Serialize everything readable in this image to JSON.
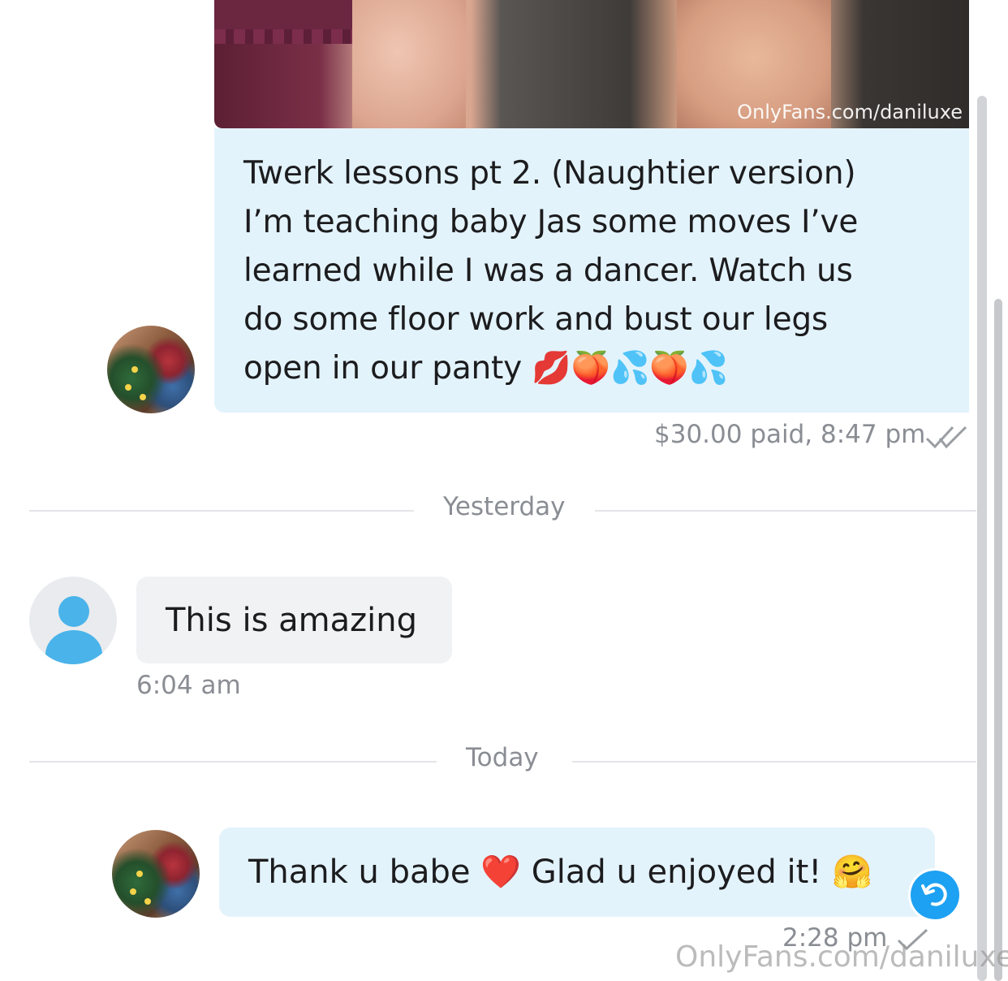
{
  "media_message": {
    "watermark": "OnlyFans.com/daniluxe"
  },
  "messages": [
    {
      "text": "Twerk lessons pt 2. (Naughtier version)\nI’m teaching baby Jas some moves I’ve\nlearned while I was a dancer. Watch us\ndo some floor work and bust our legs\nopen in our panty 💋🍑💦🍑💦",
      "meta": "$30.00 paid,  8:47 pm"
    },
    {
      "text": "This is amazing",
      "meta": "6:04 am"
    },
    {
      "text": "Thank u babe ❤️ Glad u enjoyed it! 🤗",
      "meta": "2:28 pm"
    }
  ],
  "day_separators": [
    "Yesterday",
    "Today"
  ],
  "overlay_watermark": "OnlyFans.com/daniluxe",
  "colors": {
    "sent_bubble": "#e3f3fc",
    "received_bubble": "#f1f2f4",
    "accent": "#1da1f2",
    "meta_text": "#8a8d93"
  },
  "icons": {
    "read_receipt": "double-check-icon",
    "sent_receipt": "check-icon",
    "reply": "reply-arrow-icon",
    "default_avatar": "user-silhouette-icon"
  }
}
